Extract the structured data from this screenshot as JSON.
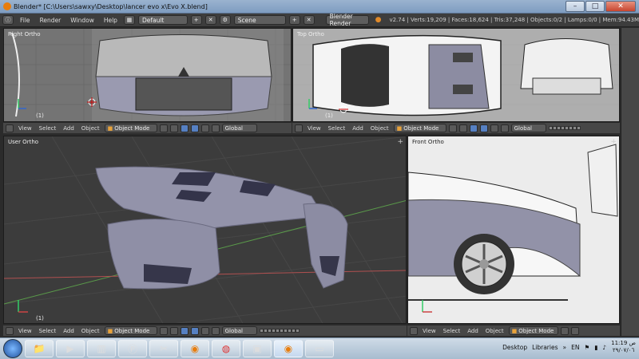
{
  "window": {
    "title": "Blender* [C:\\Users\\sawxy\\Desktop\\lancer evo x\\Evo X.blend]"
  },
  "info_header": {
    "menus": [
      "File",
      "Render",
      "Window",
      "Help"
    ],
    "layout": "Default",
    "scene": "Scene",
    "engine": "Blender Render",
    "stats": "v2.74 | Verts:19,209 | Faces:18,624 | Tris:37,248 | Objects:0/2 | Lamps:0/0 | Mem:94.43M"
  },
  "viewports": {
    "right": {
      "label": "Right Ortho",
      "object": "(1)"
    },
    "top": {
      "label": "Top Ortho",
      "object": "(1)"
    },
    "user": {
      "label": "User Ortho",
      "object": "(1)"
    },
    "front": {
      "label": "Front Ortho",
      "object": ""
    }
  },
  "viewport_header": {
    "menus": [
      "View",
      "Select",
      "Add",
      "Object"
    ],
    "mode": "Object Mode",
    "orientation": "Global"
  },
  "taskbar": {
    "desktop": "Desktop",
    "libraries": "Libraries",
    "lang": "EN",
    "time": "11:19 ص",
    "date": "٢٩/٠٧/٠٦"
  },
  "colors": {
    "viewport_bg": "#747474",
    "mesh": "#8e8ea6",
    "grid_red": "#b05050",
    "grid_green": "#5a9a4a"
  }
}
